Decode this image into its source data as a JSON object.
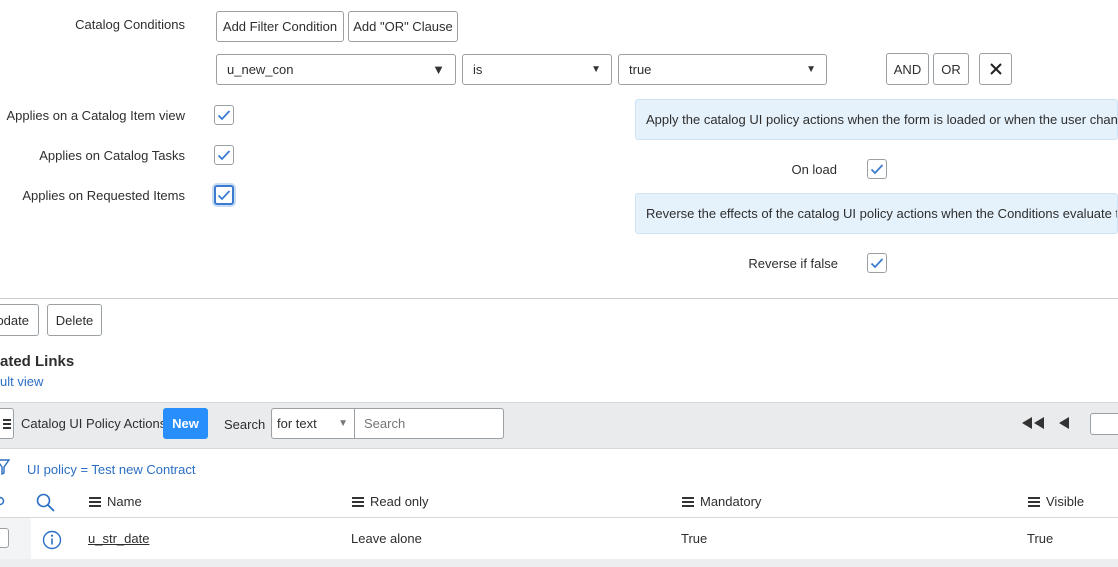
{
  "conditions": {
    "label": "Catalog Conditions",
    "add_filter_label": "Add Filter Condition",
    "add_or_label": "Add \"OR\" Clause",
    "field_value": "u_new_con",
    "operator_value": "is",
    "value_value": "true",
    "and_label": "AND",
    "or_label": "OR"
  },
  "options": {
    "catalog_item_view_label": "Applies on a Catalog Item view",
    "catalog_tasks_label": "Applies on Catalog Tasks",
    "requested_items_label": "Applies on Requested Items",
    "onload_info": "Apply the catalog UI policy actions when the form is loaded or when the user changes va",
    "onload_label": "On load",
    "reverse_info": "Reverse the effects of the catalog UI policy actions when the Conditions evaluate to false",
    "reverse_label": "Reverse if false"
  },
  "actions": {
    "update_label": "odate",
    "delete_label": "Delete"
  },
  "related": {
    "title": "ated Links",
    "default_view": "ult view"
  },
  "list": {
    "title": "Catalog UI Policy Actions",
    "new_label": "New",
    "search_label": "Search",
    "search_field": "for text",
    "search_placeholder": "Search",
    "breadcrumb": "UI policy = Test new Contract",
    "columns": [
      "Name",
      "Read only",
      "Mandatory",
      "Visible"
    ],
    "rows": [
      {
        "name": "u_str_date",
        "read_only": "Leave alone",
        "mandatory": "True",
        "visible": "True"
      }
    ]
  },
  "colors": {
    "accent": "#278efc",
    "info_bg": "#e5f2fc",
    "link": "#2b6fc4"
  }
}
